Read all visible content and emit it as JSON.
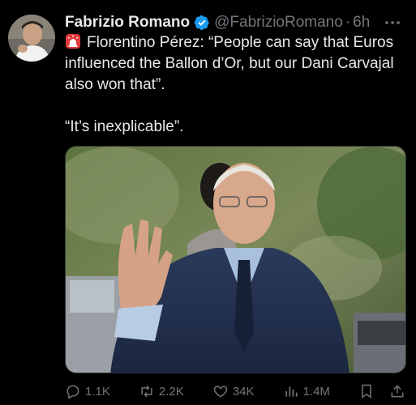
{
  "author": {
    "name": "Fabrizio Romano",
    "handle": "@FabrizioRomano",
    "separator": "·",
    "time": "6h"
  },
  "icons": {
    "verified": "verified-badge-icon",
    "more": "more-options-icon",
    "siren": "siren-emoji-icon"
  },
  "tweet": {
    "line1": "Florentino Pérez: “People can say that Euros influenced the Ballon d’Or, but our Dani Carvajal also won that”.",
    "line2": "“It’s inexplicable”."
  },
  "actions": {
    "replies": "1.1K",
    "retweets": "2.2K",
    "likes": "34K",
    "views": "1.4M"
  },
  "colors": {
    "background": "#000000",
    "text": "#e7e9ea",
    "muted": "#71767b",
    "verified": "#1d9bf0"
  }
}
